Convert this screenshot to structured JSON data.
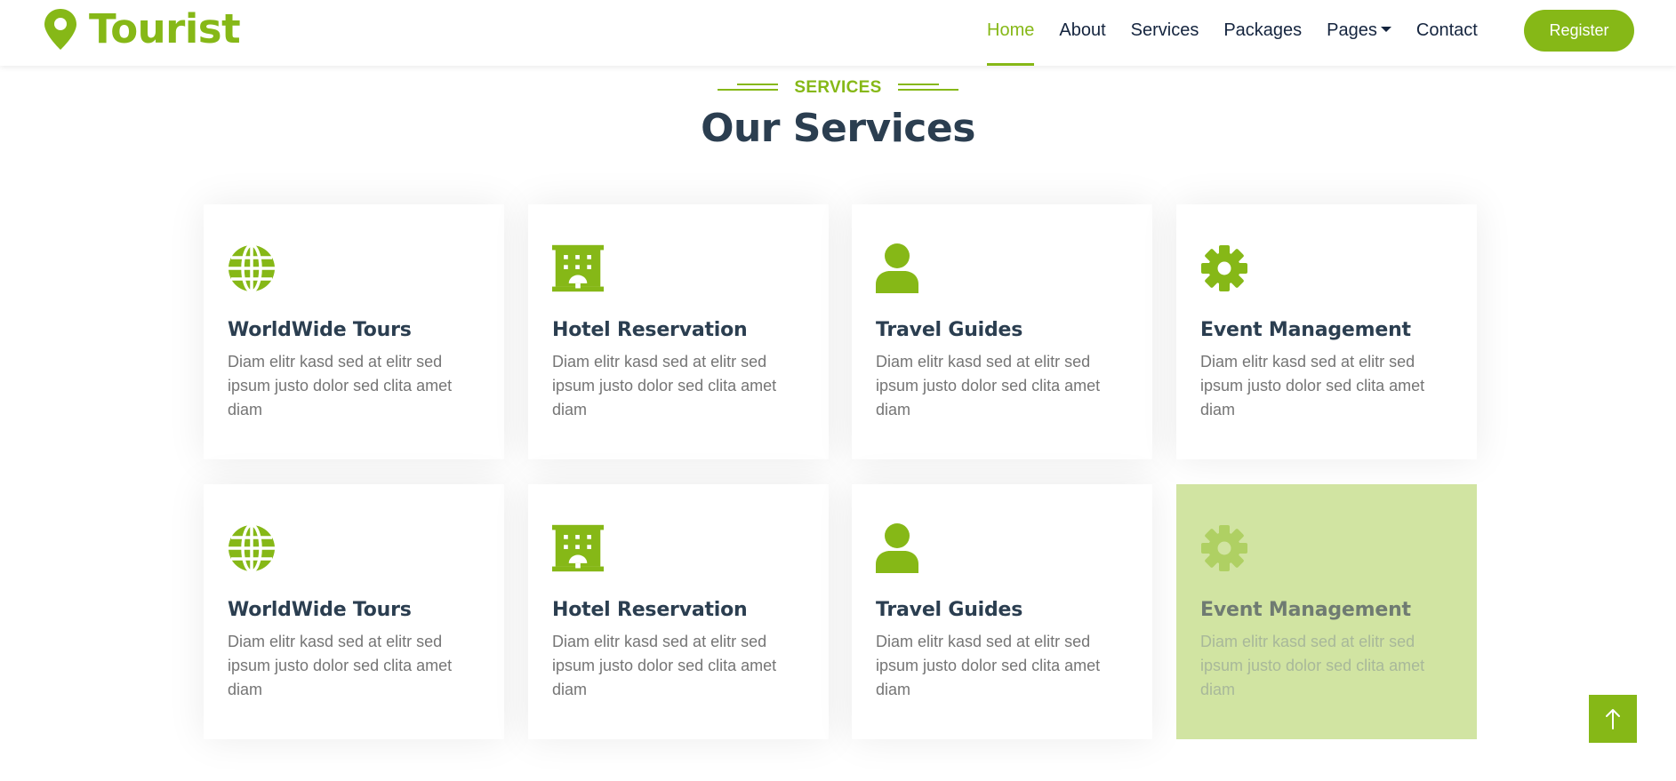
{
  "brand": {
    "name": "Tourist",
    "icon": "map-marker-icon"
  },
  "nav": {
    "items": [
      {
        "label": "Home",
        "active": true
      },
      {
        "label": "About",
        "active": false
      },
      {
        "label": "Services",
        "active": false
      },
      {
        "label": "Packages",
        "active": false
      },
      {
        "label": "Pages",
        "active": false,
        "dropdown": true
      },
      {
        "label": "Contact",
        "active": false
      }
    ],
    "register_label": "Register"
  },
  "section": {
    "tag": "SERVICES",
    "title": "Our Services"
  },
  "services": [
    {
      "icon": "globe-icon",
      "title": "WorldWide Tours",
      "text": "Diam elitr kasd sed at elitr sed ipsum justo dolor sed clita amet diam"
    },
    {
      "icon": "hotel-icon",
      "title": "Hotel Reservation",
      "text": "Diam elitr kasd sed at elitr sed ipsum justo dolor sed clita amet diam"
    },
    {
      "icon": "user-icon",
      "title": "Travel Guides",
      "text": "Diam elitr kasd sed at elitr sed ipsum justo dolor sed clita amet diam"
    },
    {
      "icon": "gear-icon",
      "title": "Event Management",
      "text": "Diam elitr kasd sed at elitr sed ipsum justo dolor sed clita amet diam"
    },
    {
      "icon": "globe-icon",
      "title": "WorldWide Tours",
      "text": "Diam elitr kasd sed at elitr sed ipsum justo dolor sed clita amet diam"
    },
    {
      "icon": "hotel-icon",
      "title": "Hotel Reservation",
      "text": "Diam elitr kasd sed at elitr sed ipsum justo dolor sed clita amet diam"
    },
    {
      "icon": "user-icon",
      "title": "Travel Guides",
      "text": "Diam elitr kasd sed at elitr sed ipsum justo dolor sed clita amet diam"
    },
    {
      "icon": "gear-icon",
      "title": "Event Management",
      "text": "Diam elitr kasd sed at elitr sed ipsum justo dolor sed clita amet diam"
    }
  ],
  "colors": {
    "accent": "#86b817",
    "heading": "#2b3e50",
    "body_text": "#757575",
    "highlight_card": "#d1e4a2"
  },
  "back_to_top": {
    "icon": "arrow-up-icon"
  }
}
